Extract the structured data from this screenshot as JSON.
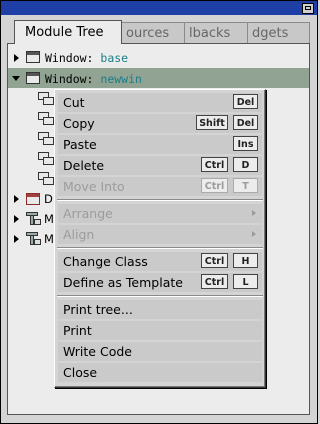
{
  "tabs": [
    "Module Tree",
    "ources",
    "lbacks",
    "dgets"
  ],
  "tree": {
    "rows": [
      {
        "label": "Window:",
        "name": "base"
      },
      {
        "label": "Window:",
        "name": "newwin"
      }
    ],
    "partial_labels": [
      "D",
      "M",
      "M"
    ]
  },
  "context_menu": {
    "items": [
      {
        "label": "Cut",
        "keys": [
          "Del"
        ],
        "enabled": true
      },
      {
        "label": "Copy",
        "keys": [
          "Shift",
          "Del"
        ],
        "enabled": true
      },
      {
        "label": "Paste",
        "keys": [
          "Ins"
        ],
        "enabled": true
      },
      {
        "label": "Delete",
        "keys": [
          "Ctrl",
          "D"
        ],
        "enabled": true
      },
      {
        "label": "Move Into",
        "keys": [
          "Ctrl",
          "T"
        ],
        "enabled": false
      },
      {
        "label": "Arrange",
        "submenu": true,
        "enabled": false
      },
      {
        "label": "Align",
        "submenu": true,
        "enabled": false
      },
      {
        "label": "Change Class",
        "keys": [
          "Ctrl",
          "H"
        ],
        "enabled": true
      },
      {
        "label": "Define as Template",
        "keys": [
          "Ctrl",
          "L"
        ],
        "enabled": true
      },
      {
        "label": "Print tree...",
        "enabled": true
      },
      {
        "label": "Print",
        "enabled": true
      },
      {
        "label": "Write Code",
        "enabled": true
      },
      {
        "label": "Close",
        "enabled": true
      }
    ]
  },
  "colors": {
    "titlebar": "#1e3fa5",
    "selection": "#91a393",
    "widget_name": "#1c7e8a"
  }
}
